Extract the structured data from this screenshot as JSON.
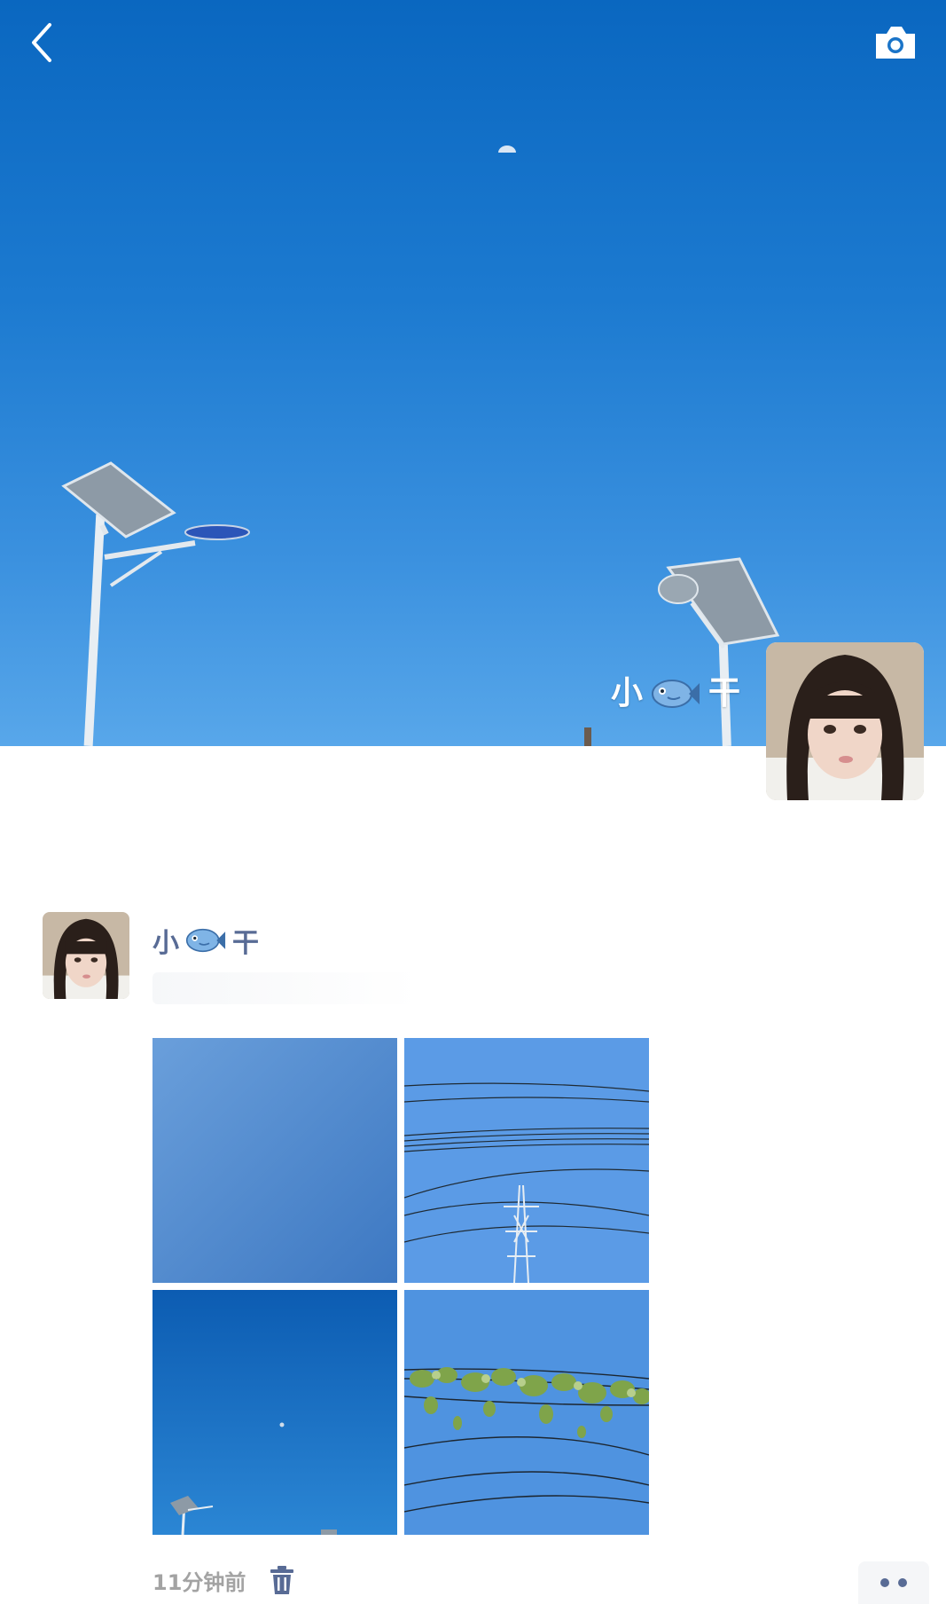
{
  "cover": {
    "nickname_prefix": "小",
    "nickname_suffix": "干"
  },
  "icons": {
    "back": "chevron-left-icon",
    "camera": "camera-icon",
    "fish": "fish-emoji",
    "delete": "trash-icon",
    "more": "more-dots-icon"
  },
  "post": {
    "author_prefix": "小",
    "author_suffix": "干",
    "timestamp": "11分钟前",
    "photos": [
      "sky-gradient",
      "power-lines-tower",
      "deep-blue-sky-moon",
      "vines-on-wires"
    ]
  },
  "colors": {
    "sky_top": "#0a67c0",
    "sky_bottom": "#58a7ea",
    "name_link": "#586b95",
    "timestamp": "#a3a3a3"
  }
}
